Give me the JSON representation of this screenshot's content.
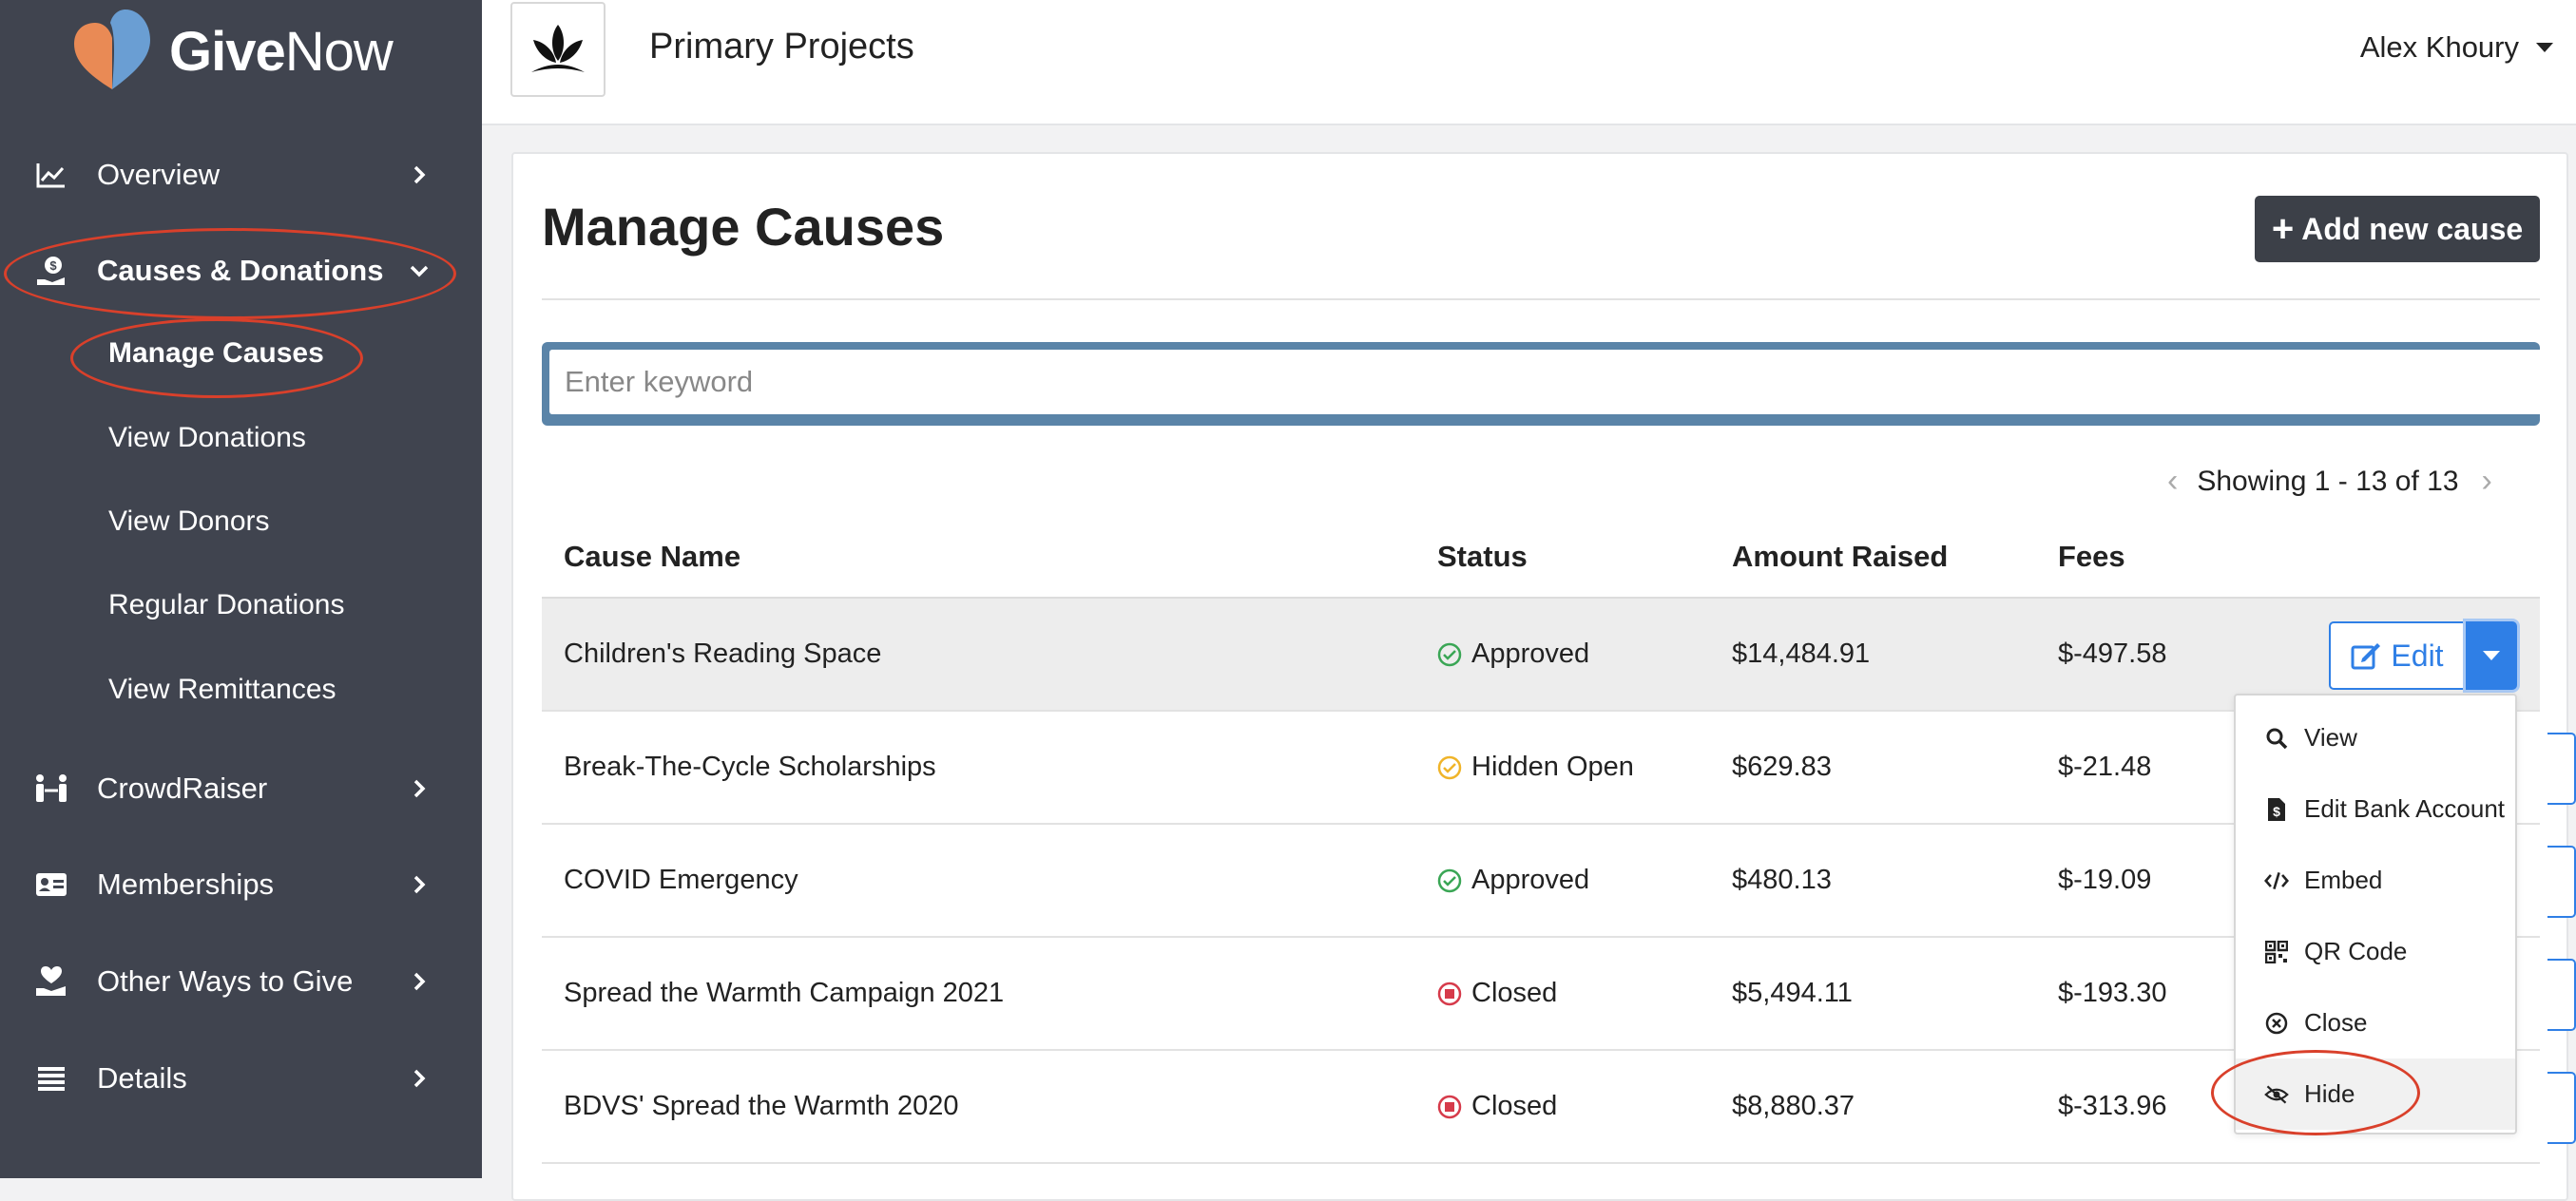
{
  "brand": {
    "name_bold": "Give",
    "name_light": "Now"
  },
  "sidebar": {
    "items": [
      {
        "label": "Overview",
        "icon": "chart-line-icon"
      },
      {
        "label": "Causes & Donations",
        "icon": "hand-money-icon"
      },
      {
        "label": "CrowdRaiser",
        "icon": "people-link-icon"
      },
      {
        "label": "Memberships",
        "icon": "id-card-icon"
      },
      {
        "label": "Other Ways to Give",
        "icon": "hand-heart-icon"
      },
      {
        "label": "Details",
        "icon": "list-icon"
      }
    ],
    "subitems": [
      {
        "label": "Manage Causes"
      },
      {
        "label": "View Donations"
      },
      {
        "label": "View Donors"
      },
      {
        "label": "Regular Donations"
      },
      {
        "label": "View Remittances"
      }
    ]
  },
  "header": {
    "org_title": "Primary Projects",
    "user_name": "Alex Khoury"
  },
  "main": {
    "title": "Manage Causes",
    "add_button": "Add new cause",
    "search_placeholder": "Enter keyword",
    "pagination": "Showing 1 - 13 of 13"
  },
  "table": {
    "columns": [
      "Cause Name",
      "Status",
      "Amount Raised",
      "Fees"
    ],
    "rows": [
      {
        "name": "Children's Reading Space",
        "status": "Approved",
        "amount": "$14,484.91",
        "fees": "$-497.58"
      },
      {
        "name": "Break-The-Cycle Scholarships",
        "status": "Hidden Open",
        "amount": "$629.83",
        "fees": "$-21.48"
      },
      {
        "name": "COVID Emergency",
        "status": "Approved",
        "amount": "$480.13",
        "fees": "$-19.09"
      },
      {
        "name": "Spread the Warmth Campaign 2021",
        "status": "Closed",
        "amount": "$5,494.11",
        "fees": "$-193.30"
      },
      {
        "name": "BDVS' Spread the Warmth 2020",
        "status": "Closed",
        "amount": "$8,880.37",
        "fees": "$-313.96"
      }
    ],
    "edit_label": "Edit"
  },
  "dropdown": {
    "items": [
      {
        "label": "View",
        "icon": "search-icon"
      },
      {
        "label": "Edit Bank Account",
        "icon": "file-dollar-icon"
      },
      {
        "label": "Embed",
        "icon": "code-icon"
      },
      {
        "label": "QR Code",
        "icon": "qrcode-icon"
      },
      {
        "label": "Close",
        "icon": "circle-x-icon"
      },
      {
        "label": "Hide",
        "icon": "eye-slash-icon"
      }
    ]
  },
  "colors": {
    "sidebar_bg": "#40444f",
    "primary_blue": "#2f7fe6",
    "approved_green": "#3aa655",
    "hidden_yellow": "#f0b429",
    "closed_red": "#d63a4a",
    "annotation_red": "#d9402b"
  }
}
